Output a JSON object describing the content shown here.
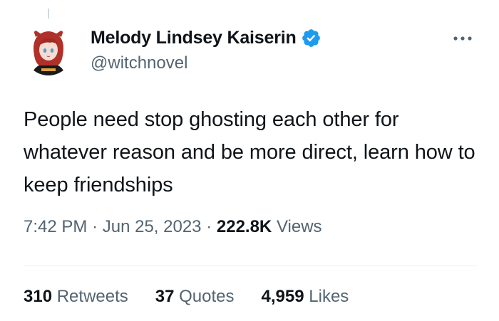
{
  "author": {
    "display_name": "Melody Lindsey Kaiserin",
    "handle": "@witchnovel",
    "verified_color": "#1d9bf0"
  },
  "tweet": {
    "text": "People need stop ghosting each other for whatever reason and be more direct, learn how to keep friendships",
    "time": "7:42 PM",
    "separator": "·",
    "date": "Jun 25, 2023",
    "views_count": "222.8K",
    "views_label": "Views"
  },
  "stats": {
    "retweets_count": "310",
    "retweets_label": "Retweets",
    "quotes_count": "37",
    "quotes_label": "Quotes",
    "likes_count": "4,959",
    "likes_label": "Likes"
  },
  "icons": {
    "verified": "verified-badge-icon",
    "more": "more-options-icon"
  },
  "colors": {
    "text_primary": "#0f1419",
    "text_secondary": "#536471",
    "divider": "#eff3f4",
    "avatar_hair": "#b0302a",
    "avatar_shirt": "#1a1a1a"
  }
}
